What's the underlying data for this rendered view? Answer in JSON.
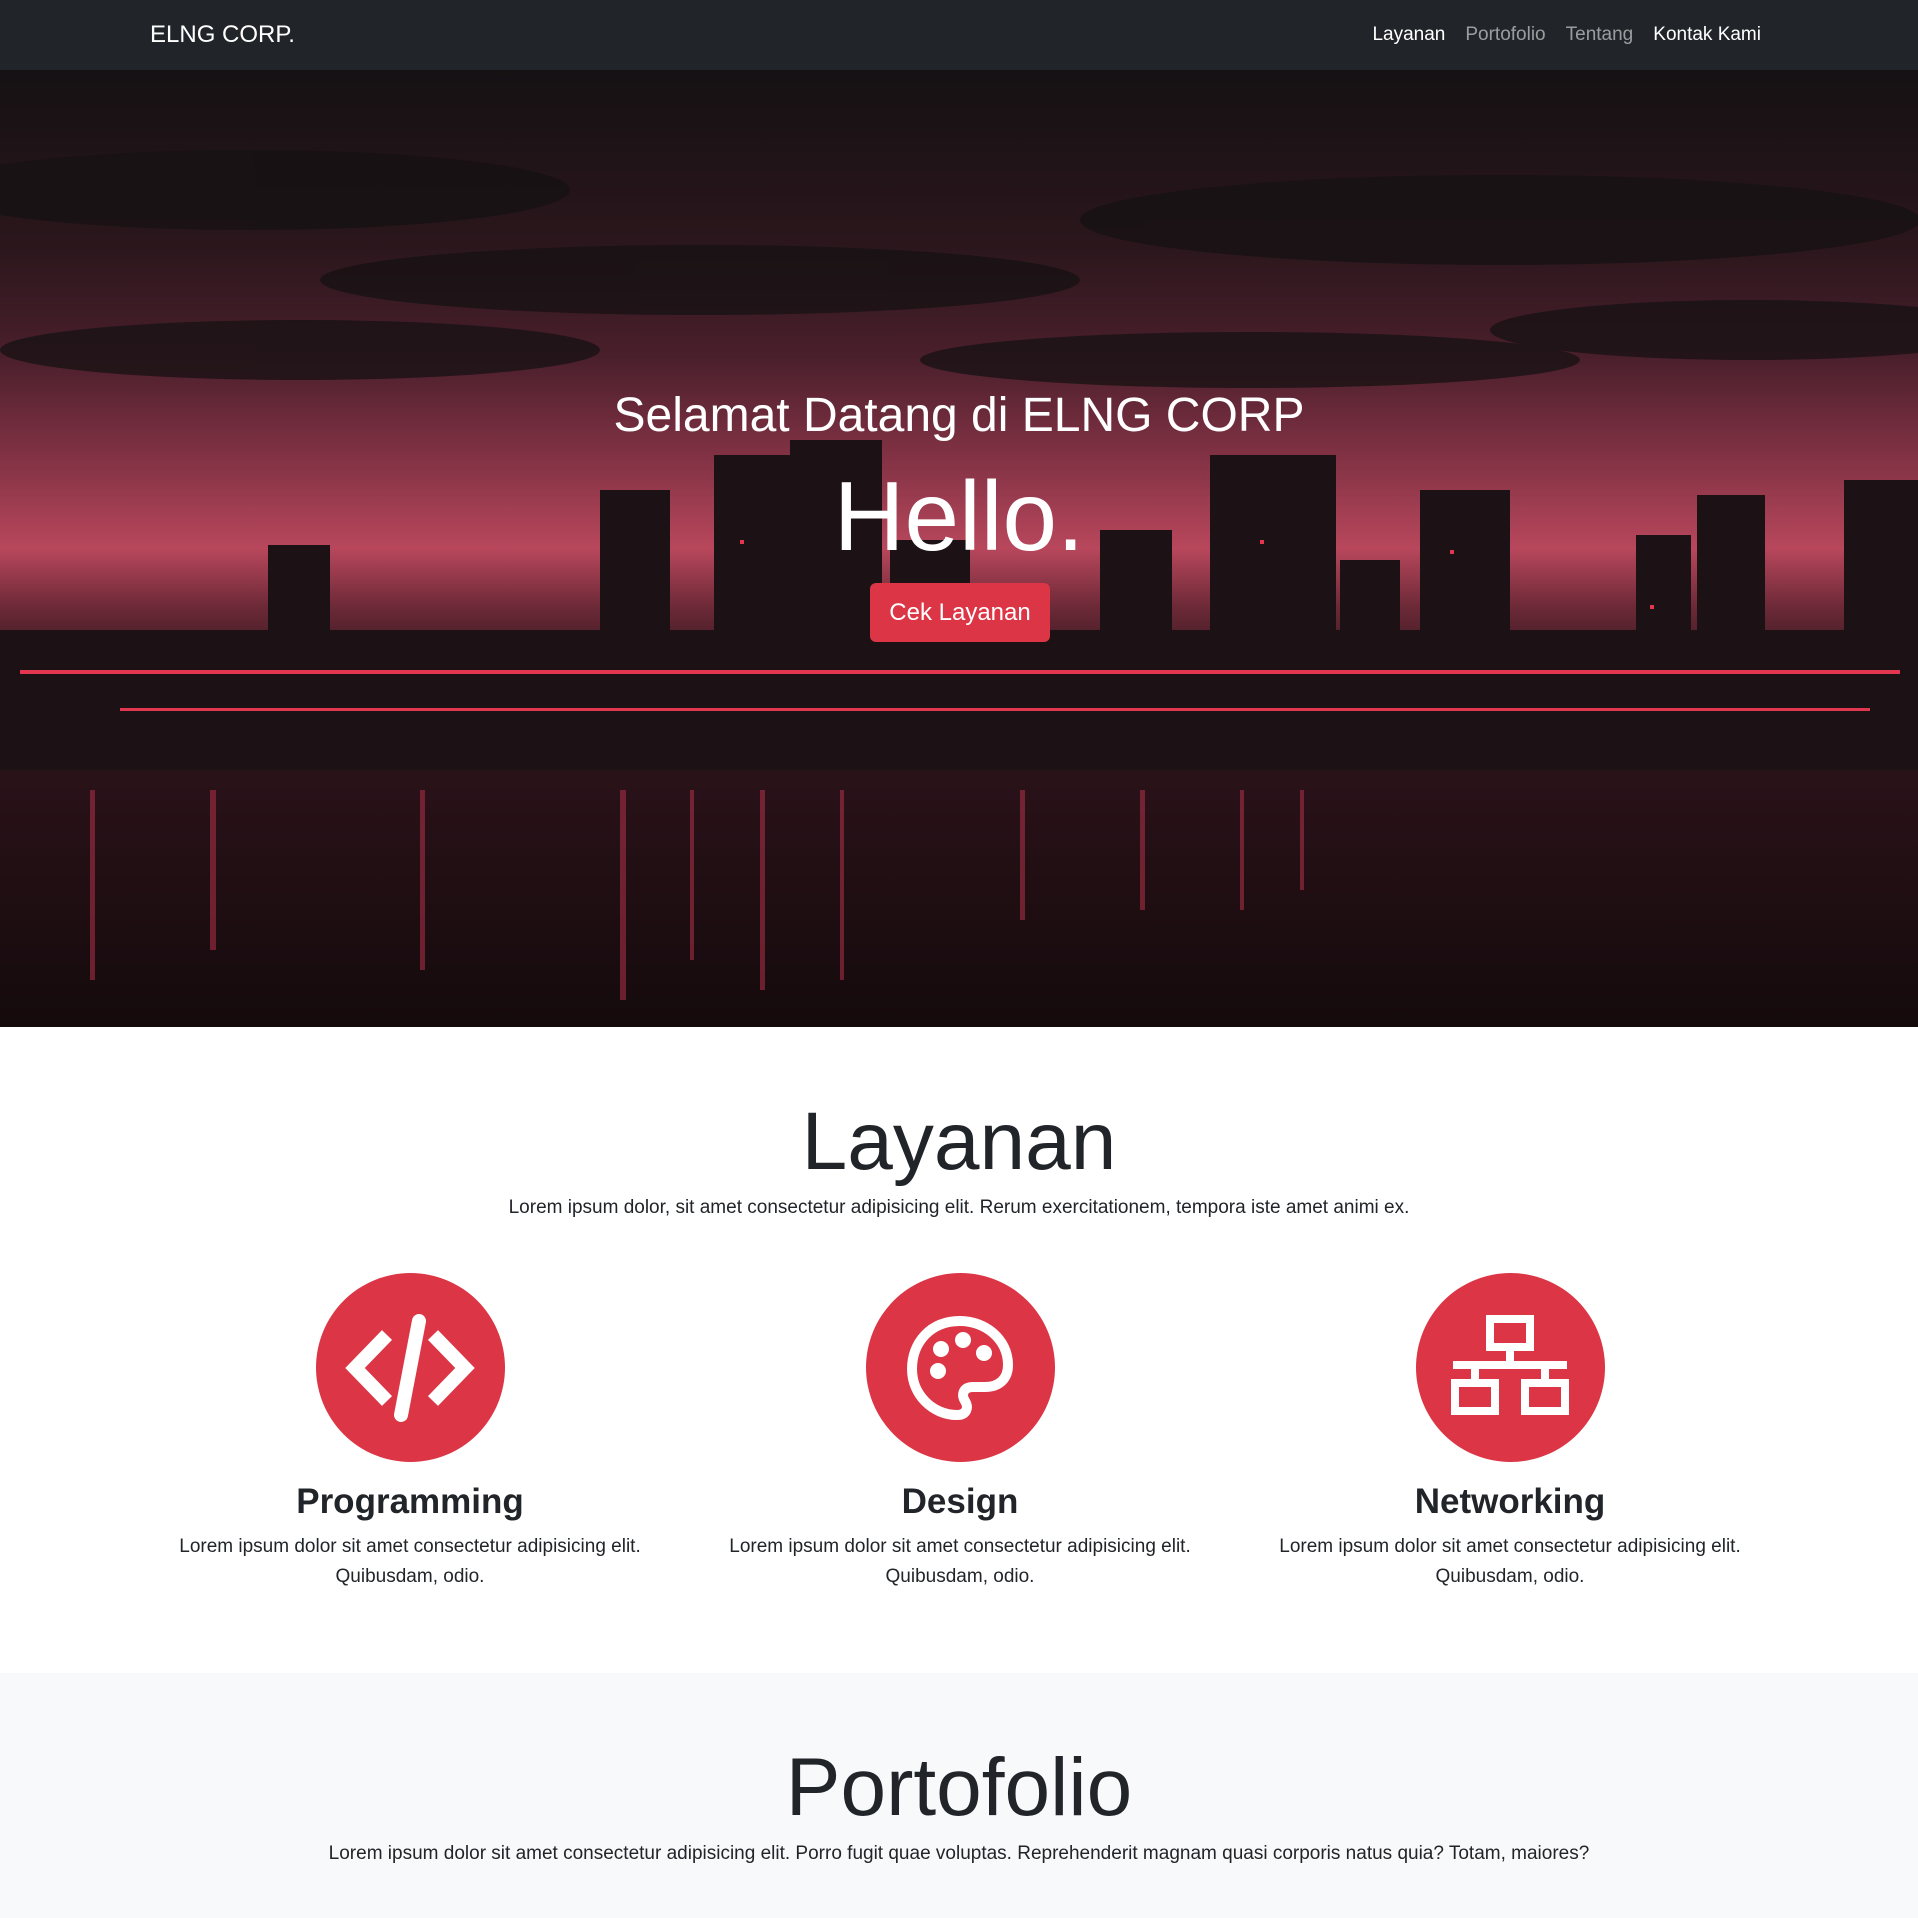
{
  "navbar": {
    "brand": "ELNG CORP.",
    "links": [
      {
        "label": "Layanan",
        "active": true
      },
      {
        "label": "Portofolio",
        "active": false
      },
      {
        "label": "Tentang",
        "active": false
      },
      {
        "label": "Kontak Kami",
        "active": true
      }
    ]
  },
  "hero": {
    "subtitle": "Selamat Datang di ELNG CORP",
    "title": "Hello.",
    "button_label": "Cek Layanan"
  },
  "services": {
    "title": "Layanan",
    "lead": "Lorem ipsum dolor, sit amet consectetur adipisicing elit. Rerum exercitationem, tempora iste amet animi ex.",
    "items": [
      {
        "icon": "code-icon",
        "title": "Programming",
        "text_line1": "Lorem ipsum dolor sit amet consectetur adipisicing elit.",
        "text_line2": "Quibusdam, odio."
      },
      {
        "icon": "palette-icon",
        "title": "Design",
        "text_line1": "Lorem ipsum dolor sit amet consectetur adipisicing elit.",
        "text_line2": "Quibusdam, odio."
      },
      {
        "icon": "network-icon",
        "title": "Networking",
        "text_line1": "Lorem ipsum dolor sit amet consectetur adipisicing elit.",
        "text_line2": "Quibusdam, odio."
      }
    ]
  },
  "portfolio": {
    "title": "Portofolio",
    "lead": "Lorem ipsum dolor sit amet consectetur adipisicing elit. Porro fugit quae voluptas. Reprehenderit magnam quasi corporis natus quia? Totam, maiores?"
  },
  "colors": {
    "accent": "#dc3545",
    "navbar_bg": "#212529",
    "section_alt_bg": "#f8f9fa"
  }
}
